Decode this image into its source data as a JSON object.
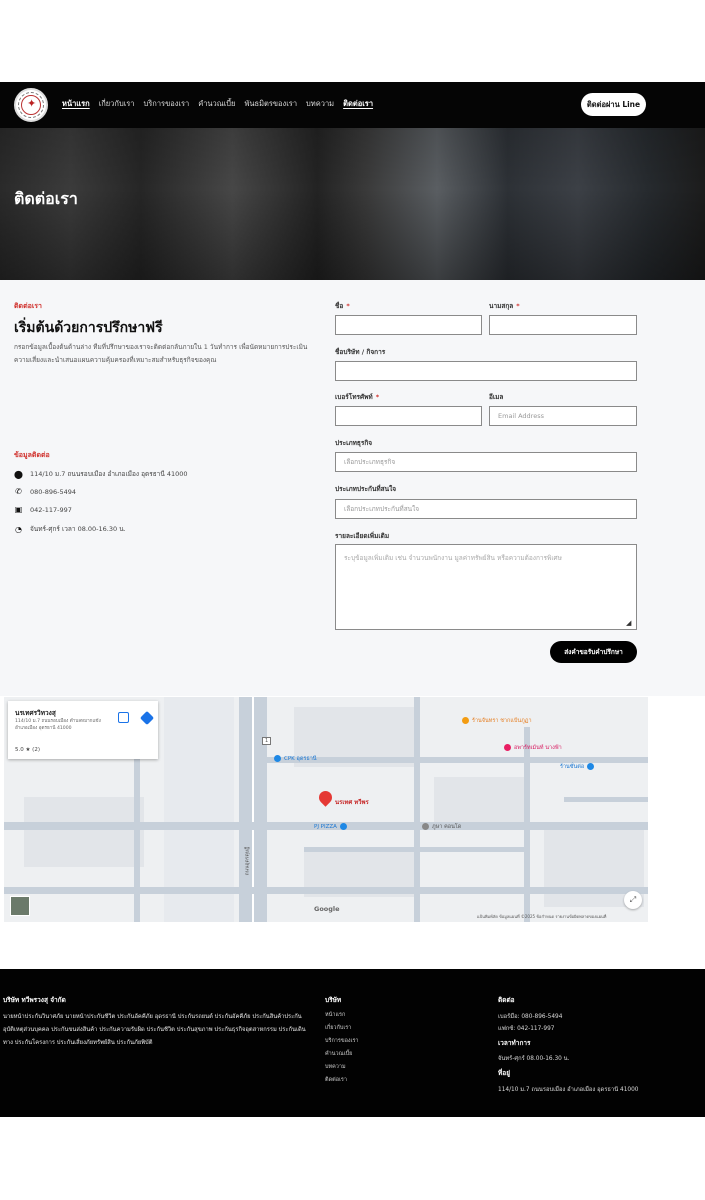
{
  "nav": {
    "items": [
      "หน้าแรก",
      "เกี่ยวกับเรา",
      "บริการของเรา",
      "คำนวณเบี้ย",
      "พันธมิตรของเรา",
      "บทความ",
      "ติดต่อเรา"
    ],
    "line_button": "ติดต่อผ่าน Line"
  },
  "hero": {
    "title": "ติดต่อเรา"
  },
  "contact": {
    "eyebrow": "ติดต่อเรา",
    "heading": "เริ่มต้นด้วยการปรึกษาฟรี",
    "description": "กรอกข้อมูลเบื้องต้นด้านล่าง ทีมที่ปรึกษาของเราจะติดต่อกลับภายใน 1 วันทำการ เพื่อนัดหมายการประเมินความเสี่ยงและนำเสนอแผนความคุ้มครองที่เหมาะสมสำหรับธุรกิจของคุณ",
    "info_title": "ข้อมูลติดต่อ",
    "address": "114/10 ม.7 ถนนรอบเมือง อำเภอเมือง อุดรธานี 41000",
    "phone": "080-896-5494",
    "fax": "042-117-997",
    "hours": "จันทร์-ศุกร์ เวลา 08.00-16.30 น."
  },
  "form": {
    "first_name_label": "ชื่อ",
    "last_name_label": "นามสกุล",
    "company_label": "ชื่อบริษัท / กิจการ",
    "phone_label": "เบอร์โทรศัพท์",
    "email_label": "อีเมล",
    "email_placeholder": "Email Address",
    "business_type_label": "ประเภทธุรกิจ",
    "business_type_value": "เลือกประเภทธุรกิจ",
    "insurance_type_label": "ประเภทประกันที่สนใจ",
    "insurance_type_value": "เลือกประเภทประกันที่สนใจ",
    "details_label": "รายละเอียดเพิ่มเติม",
    "details_placeholder": "ระบุข้อมูลเพิ่มเติม เช่น จำนวนพนักงาน มูลค่าทรัพย์สิน หรือความต้องการพิเศษ",
    "required_mark": "*",
    "submit": "ส่งคำขอรับคำปรึกษา"
  },
  "map": {
    "place_name": "นรเทศรวิทวงสุ",
    "place_address": "114/10 ม.7 ถนนรอบเมือง ตำบลหมากแข้ง อำเภอเมือง อุดรธานี 41000",
    "rating": "5.0 ★ (2)",
    "pin_label": "นรเทศ ทวีพร",
    "poi_1": "ร้านจันทรา ชากแป้นภูฏา",
    "poi_2": "อพาร์ทเม้นท์ นางฟ้า",
    "poi_3": "ร้านซั่นต่อ",
    "poi_4": "CPK อุดรธานี",
    "poi_5": "PJ PIZZA",
    "poi_6": "ภูษา คอนโด",
    "road_1": "ถนนอุดรดุษฎี",
    "google": "Google",
    "footer_text": "แป้นพิมพ์ลัด  ข้อมูลแผนที่ ©2025  ข้อกำหนด  รายงานข้อผิดพลาดของแผนที่",
    "route_num": "1"
  },
  "footer": {
    "company": "บริษัท ทวีพรวงสุ จำกัด",
    "description": "นายหน้าประกันวินาศภัย นายหน้าประกันชีวิต ประกันอัคคีภัย อุดรธานี ประกันรถยนต์ ประกันอัคคีภัย ประกันสินค้าประกันอุบัติเหตุส่วนบุคคล ประกันขนส่งสินค้า ประกันความรับผิด ประกันชีวิต ประกันสุขภาพ ประกันธุรกิจอุตสาหกรรม ประกันเดินทาง ประกันโครงการ ประกันเสี่ยงภัยทรัพย์สิน ประกันภัยพิบัติ",
    "col2_title": "บริษัท",
    "links": [
      "หน้าแรก",
      "เกี่ยวกับเรา",
      "บริการของเรา",
      "คำนวณเบี้ย",
      "บทความ",
      "ติดต่อเรา"
    ],
    "col3_title": "ติดต่อ",
    "mobile": "เบอร์มือ: 080-896-5494",
    "office": "แฟกซ์: 042-117-997",
    "hours_title": "เวลาทำการ",
    "hours": "จันทร์-ศุกร์ 08.00-16.30 น.",
    "address_title": "ที่อยู่",
    "address": "114/10 ม.7 ถนนรอบเมือง อำเภอเมือง อุดรธานี 41000"
  }
}
